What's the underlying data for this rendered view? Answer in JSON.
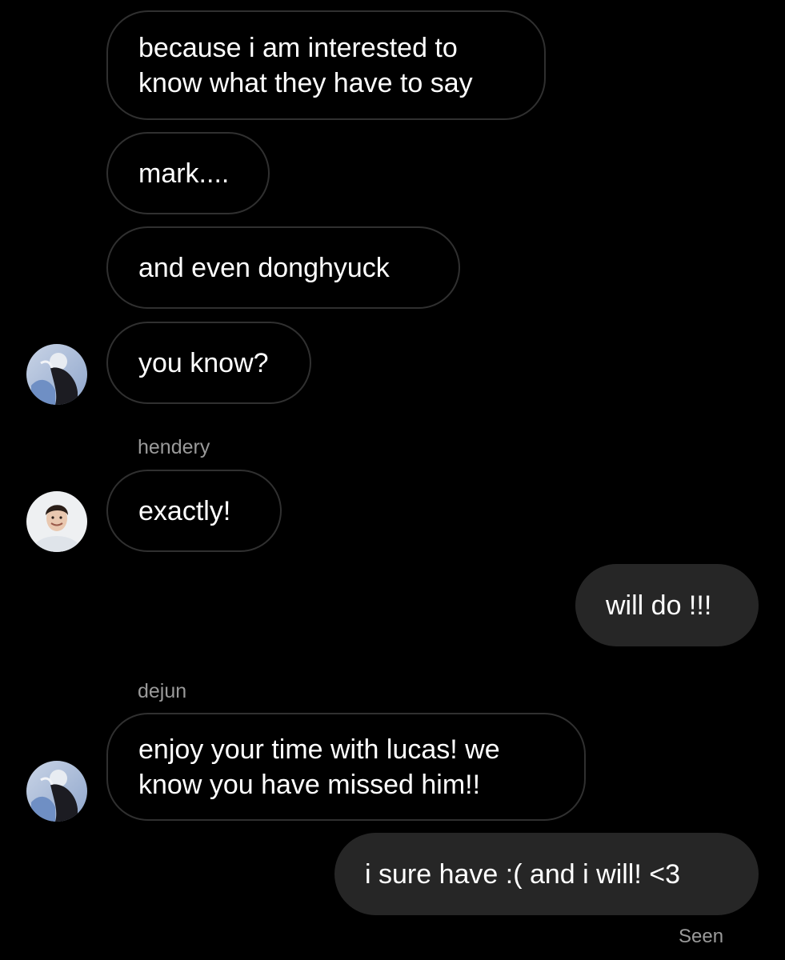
{
  "messages": {
    "m1": "because i am interested to\nknow what they have to say",
    "m2": "mark....",
    "m3": "and even donghyuck",
    "m4": "you know?",
    "m5": "exactly!",
    "m6": "will do !!!",
    "m7": "enjoy your time with lucas! we\nknow you have missed him!!",
    "m8": "i sure have :( and i will! <3"
  },
  "senders": {
    "hendery": "hendery",
    "dejun": "dejun"
  },
  "status": {
    "seen": "Seen"
  },
  "colors": {
    "background": "#000000",
    "incoming_border": "#303030",
    "outgoing_fill": "#262626",
    "meta_text": "#9a9a9a"
  },
  "icons": {
    "avatar_a": "profile-photo-avatar",
    "avatar_b": "profile-photo-avatar"
  }
}
